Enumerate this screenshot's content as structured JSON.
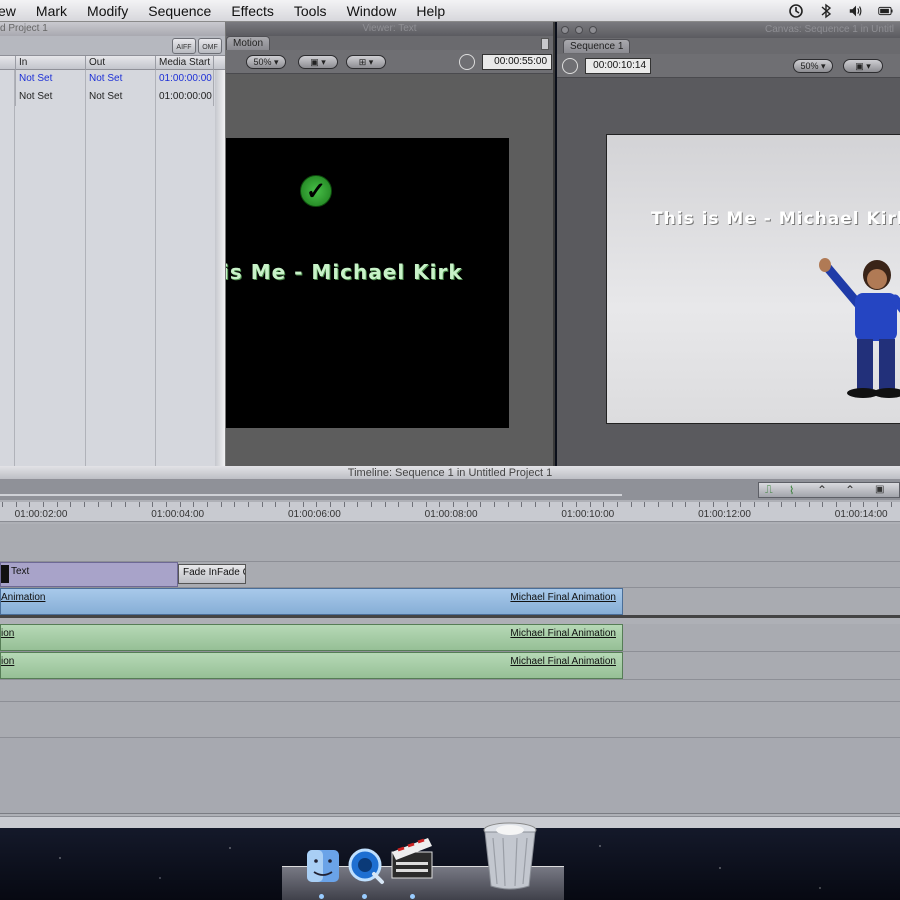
{
  "menubar": {
    "items": [
      "ew",
      "Mark",
      "Modify",
      "Sequence",
      "Effects",
      "Tools",
      "Window",
      "Help"
    ],
    "status_icons": [
      "time-machine-icon",
      "bluetooth-icon",
      "volume-icon",
      "battery-icon"
    ]
  },
  "browser": {
    "title": "d Project 1",
    "buttons": {
      "aiff": "AIFF",
      "omf": "OMF"
    },
    "columns": [
      "In",
      "Out",
      "Media Start"
    ],
    "rows": [
      {
        "in": "Not Set",
        "out": "Not Set",
        "media_start": "01:00:00:00"
      },
      {
        "in": "Not Set",
        "out": "Not Set",
        "media_start": "01:00:00:00"
      }
    ]
  },
  "viewer": {
    "title": "Viewer: Text",
    "tab": "Motion",
    "zoom": "50%",
    "timecode": "00:00:55:00",
    "overlay_text": "is Me - Michael Kirk"
  },
  "canvas": {
    "title": "Canvas: Sequence 1 in Untitl",
    "tab": "Sequence 1",
    "timecode": "00:00:10:14",
    "zoom": "50%",
    "overlay_text": "This is Me - Michael Kirk"
  },
  "timeline": {
    "title": "Timeline: Sequence 1 in Untitled Project 1",
    "ruler": [
      "01:00:02:00",
      "01:00:04:00",
      "01:00:06:00",
      "01:00:08:00",
      "01:00:10:00",
      "01:00:12:00",
      "01:00:14:00"
    ],
    "text_clip": "Text",
    "transition_1": "Fade In",
    "transition_2": "Fade C",
    "video_clip_left": "Animation",
    "video_clip_right": "Michael Final Animation",
    "audio1_left": "ion",
    "audio1_right": "Michael Final Animation",
    "audio2_left": "ion",
    "audio2_right": "Michael Final Animation"
  },
  "dock": {
    "apps": [
      "finder-icon",
      "quicktime-icon",
      "final-cut-pro-icon",
      "trash-icon"
    ]
  }
}
